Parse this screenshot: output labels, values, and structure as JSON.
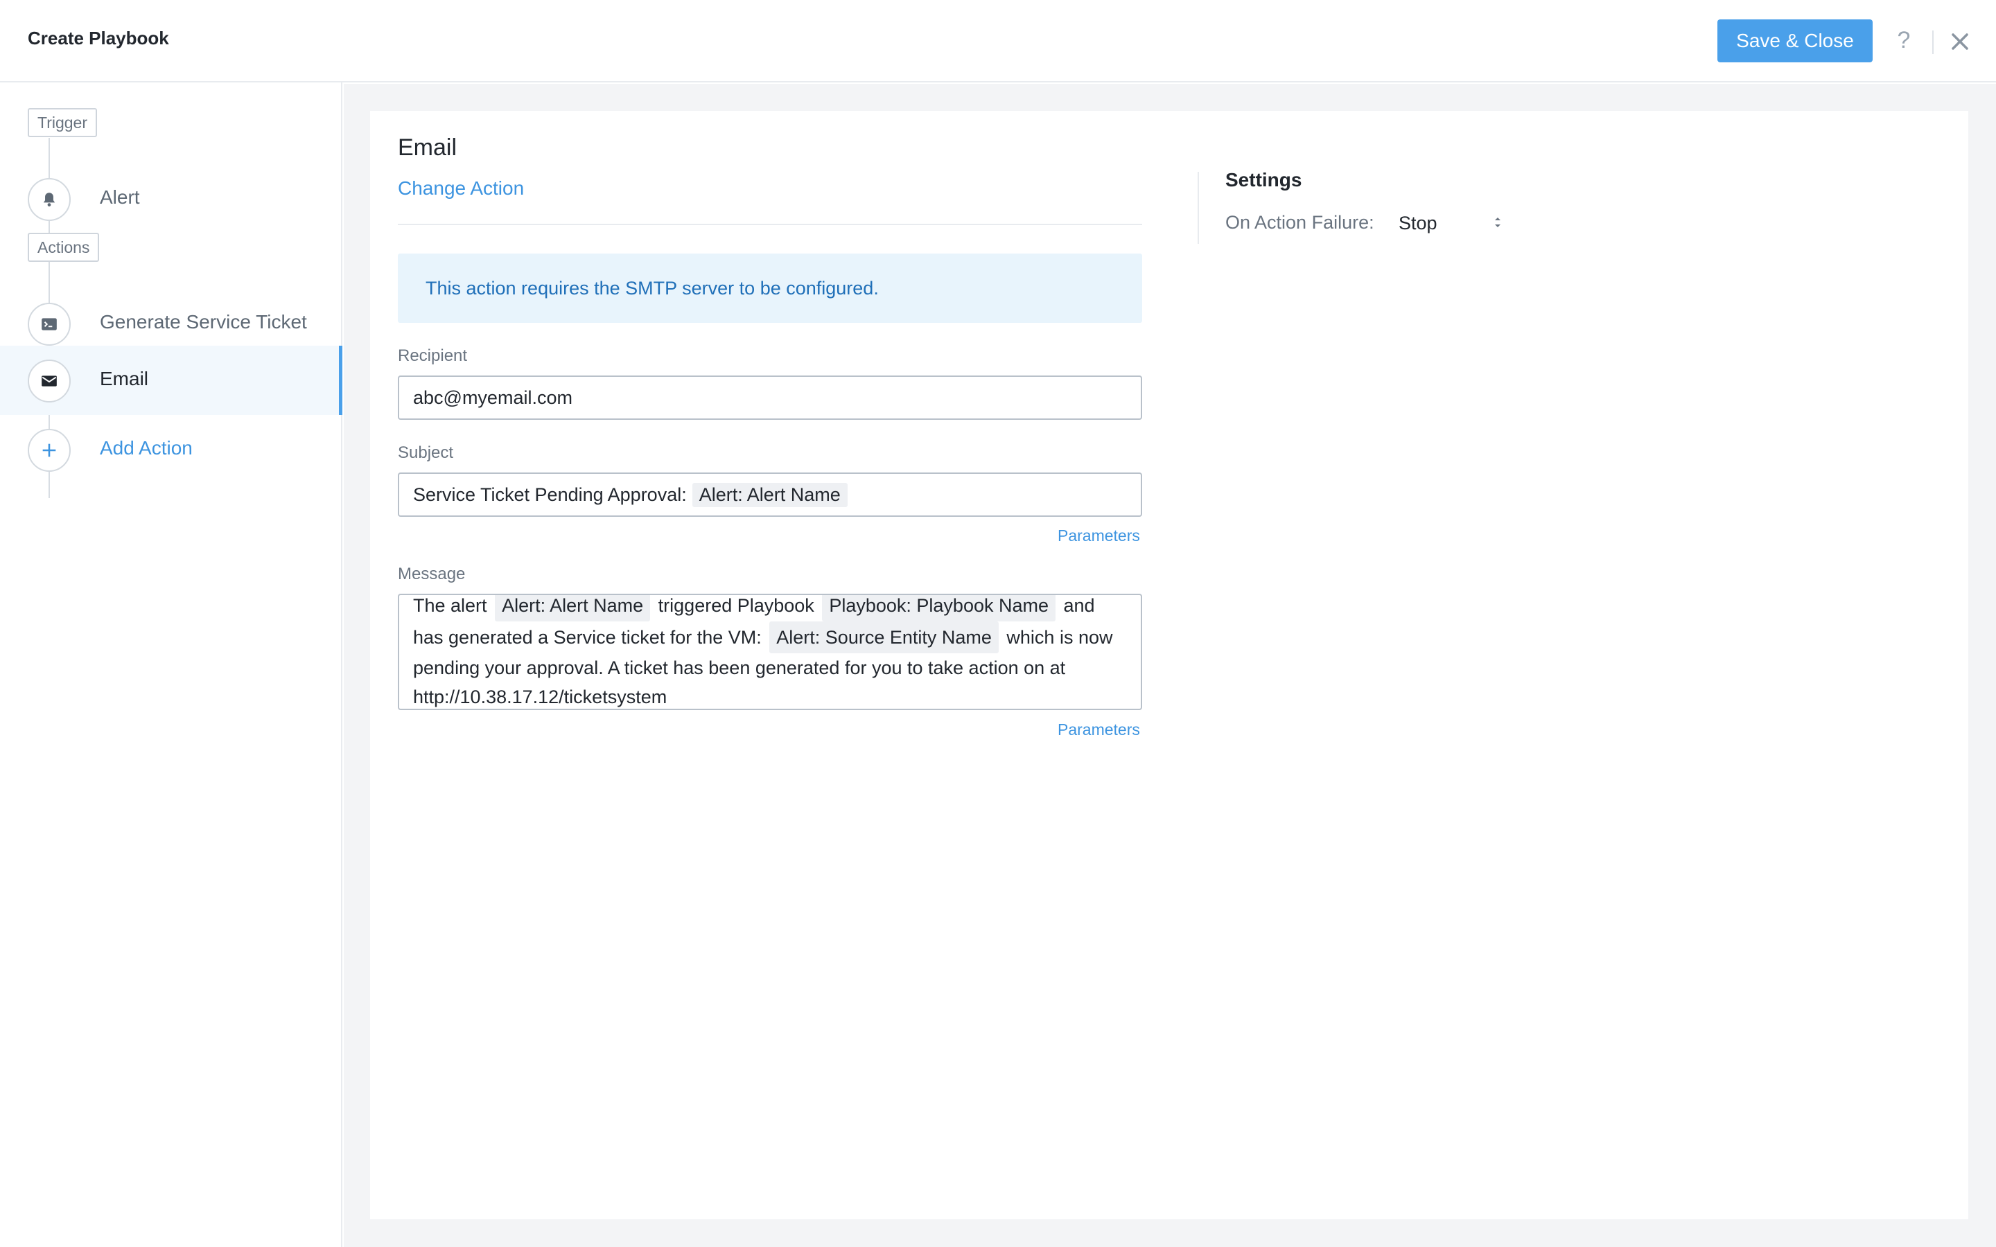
{
  "header": {
    "title": "Create Playbook",
    "save_label": "Save & Close",
    "help_label": "?"
  },
  "sidebar": {
    "trigger_tag": "Trigger",
    "actions_tag": "Actions",
    "steps": [
      {
        "label": "Alert",
        "icon": "bell-icon"
      },
      {
        "label": "Generate Service Ticket",
        "icon": "ticket-icon"
      },
      {
        "label": "Email",
        "icon": "envelope-icon",
        "active": true
      },
      {
        "label": "Add Action",
        "icon": "plus-icon"
      }
    ]
  },
  "action": {
    "title": "Email",
    "change_label": "Change Action",
    "info_banner": "This action requires the SMTP server to be configured.",
    "recipient": {
      "label": "Recipient",
      "value": "abc@myemail.com"
    },
    "subject": {
      "label": "Subject",
      "text": "Service Ticket Pending Approval:",
      "chip": "Alert: Alert Name",
      "params_label": "Parameters"
    },
    "message": {
      "label": "Message",
      "t1": "The alert",
      "chip1": "Alert: Alert Name",
      "t2": "triggered Playbook",
      "chip2": "Playbook: Playbook Name",
      "t3": "and has generated a Service ticket for the VM:",
      "chip3": "Alert: Source Entity Name",
      "t4": "which is now pending your approval. A ticket has been generated for you to take action on at http://10.38.17.12/ticketsystem",
      "params_label": "Parameters"
    }
  },
  "settings": {
    "title": "Settings",
    "failure_label": "On Action Failure:",
    "failure_value": "Stop"
  },
  "colors": {
    "accent": "#4aa0ea",
    "link": "#3d94e0",
    "banner_bg": "#e8f4fc",
    "banner_text": "#1f6fb8",
    "main_bg": "#f3f4f6"
  }
}
